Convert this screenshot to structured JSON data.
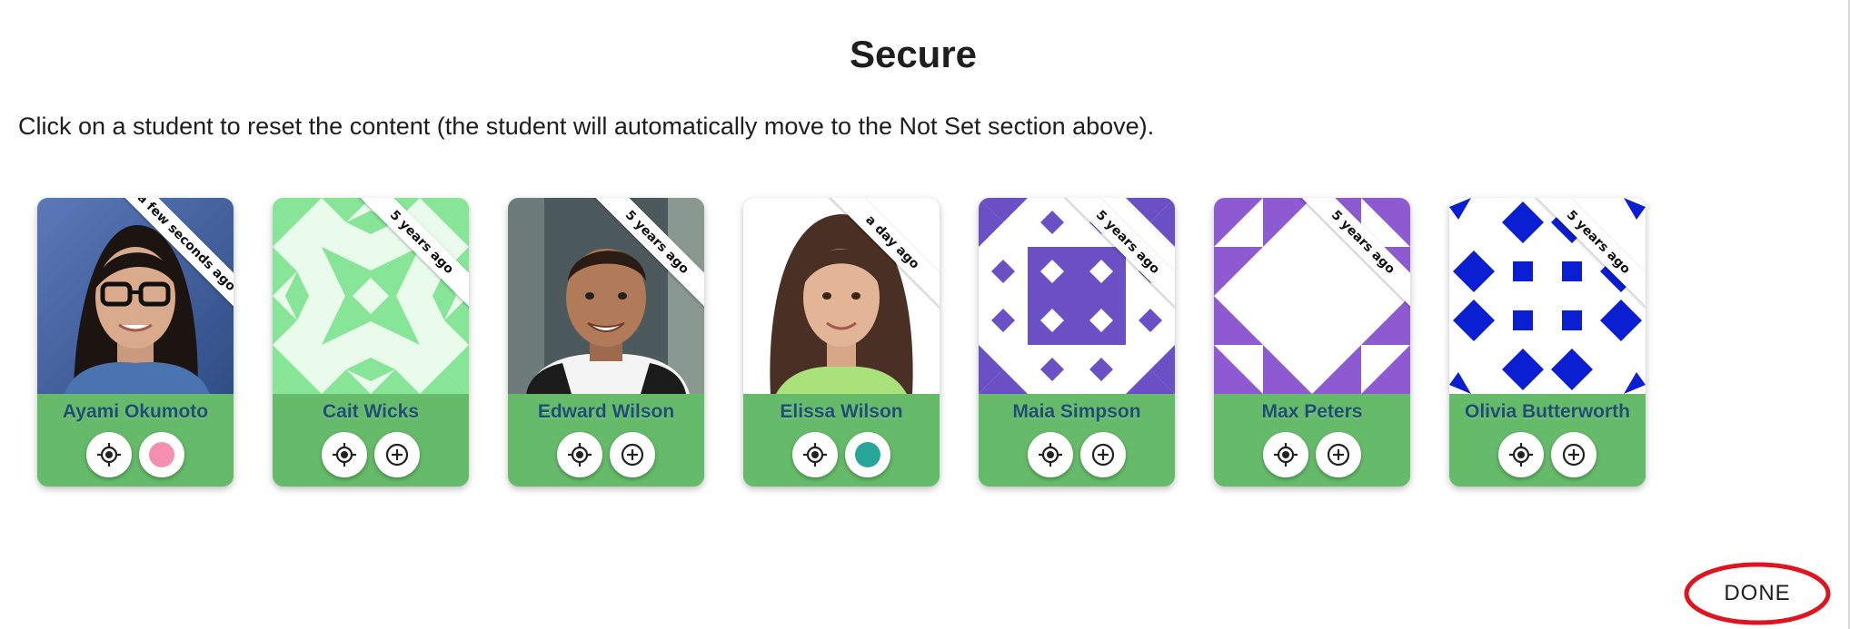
{
  "section_title": "Secure",
  "instructions": "Click on a student to reset the content (the student will automatically move to the Not Set section above).",
  "students": [
    {
      "name": "Ayami Okumoto",
      "last_active": "a few seconds ago",
      "avatar": "photo",
      "status_color": "#f48fb1"
    },
    {
      "name": "Cait Wicks",
      "last_active": "5 years ago",
      "avatar": "identicon-green",
      "status_color": null
    },
    {
      "name": "Edward Wilson",
      "last_active": "5 years ago",
      "avatar": "photo",
      "status_color": null
    },
    {
      "name": "Elissa Wilson",
      "last_active": "a day ago",
      "avatar": "photo",
      "status_color": "#26a69a"
    },
    {
      "name": "Maia Simpson",
      "last_active": "5 years ago",
      "avatar": "identicon-purple",
      "status_color": null
    },
    {
      "name": "Max Peters",
      "last_active": "5 years ago",
      "avatar": "identicon-violet",
      "status_color": null
    },
    {
      "name": "Olivia Butterworth",
      "last_active": "5 years ago",
      "avatar": "identicon-blue",
      "status_color": null
    }
  ],
  "icons": {
    "locate": "crosshair-icon",
    "add": "plus-circle-icon"
  },
  "colors": {
    "card_footer": "#66bb6a",
    "name_text": "#1f4e73",
    "done_highlight": "#e0141e"
  },
  "done_label": "DONE"
}
